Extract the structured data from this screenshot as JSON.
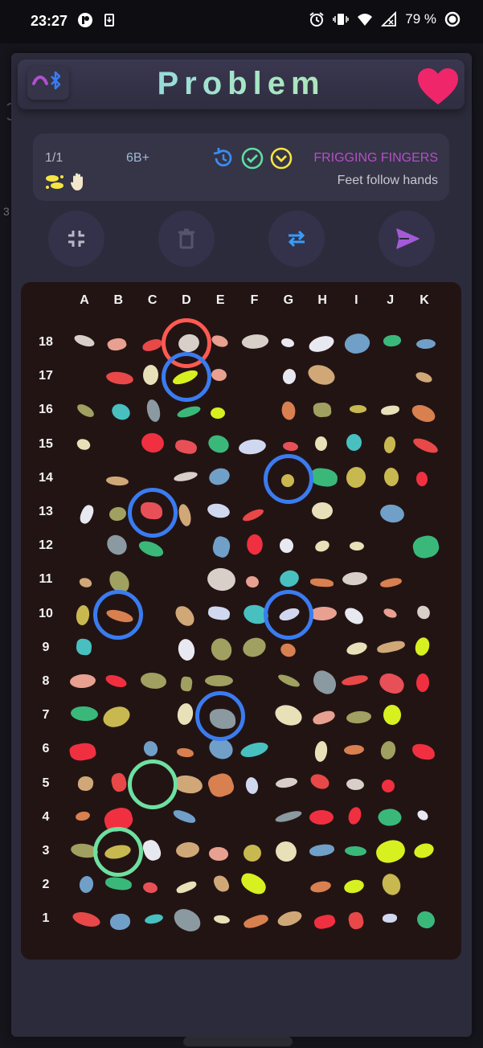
{
  "status": {
    "time": "23:27",
    "battery": "79 %",
    "left_icons": [
      "p-app-icon",
      "download-icon"
    ],
    "right_icons": [
      "alarm-icon",
      "vibrate-icon",
      "wifi-icon",
      "no-signal-icon",
      "battery-icon"
    ]
  },
  "backdrop": {
    "hint": "3"
  },
  "header": {
    "title": "Problem",
    "bluetooth_icon": "bluetooth-disconnect-icon",
    "favorite_icon": "heart-icon",
    "colors": {
      "heart": "#f0266a",
      "bt_phone": "#b04fd0",
      "bt": "#3a7cf0"
    }
  },
  "problem": {
    "count": "1/1",
    "grade": "6B+",
    "badges": [
      "history-icon",
      "check-icon",
      "chevron-down-circle-icon"
    ],
    "name": "FRIGGING FINGERS",
    "rule": "Feet follow hands",
    "icons": [
      "feet-icon",
      "hand-icon"
    ],
    "colors": {
      "name": "#b44fc8",
      "history": "#3a8cf0",
      "check": "#5ee0a0",
      "chevron": "#f5e542"
    }
  },
  "actions": [
    {
      "icon": "collapse-icon",
      "color": "#b9b8c4"
    },
    {
      "icon": "trash-icon",
      "color": "#55546a"
    },
    {
      "icon": "swap-icon",
      "color": "#3a9cf5"
    },
    {
      "icon": "send-icon",
      "color": "#a45ad8"
    }
  ],
  "board": {
    "columns": [
      "A",
      "B",
      "C",
      "D",
      "E",
      "F",
      "G",
      "H",
      "I",
      "J",
      "K"
    ],
    "rows": [
      "18",
      "17",
      "16",
      "15",
      "14",
      "13",
      "12",
      "11",
      "10",
      "9",
      "8",
      "7",
      "6",
      "5",
      "4",
      "3",
      "2",
      "1"
    ],
    "ring_colors": {
      "finish": "#ff5a52",
      "hand": "#3a7cf0",
      "start": "#6ee0a0"
    },
    "selected": [
      {
        "hold": "D18",
        "role": "finish"
      },
      {
        "hold": "D17",
        "role": "hand"
      },
      {
        "hold": "G14",
        "role": "hand"
      },
      {
        "hold": "C13",
        "role": "hand"
      },
      {
        "hold": "B10",
        "role": "hand"
      },
      {
        "hold": "G10",
        "role": "hand"
      },
      {
        "hold": "E7",
        "role": "hand"
      },
      {
        "hold": "C5",
        "role": "start"
      },
      {
        "hold": "B3",
        "role": "start"
      }
    ]
  }
}
